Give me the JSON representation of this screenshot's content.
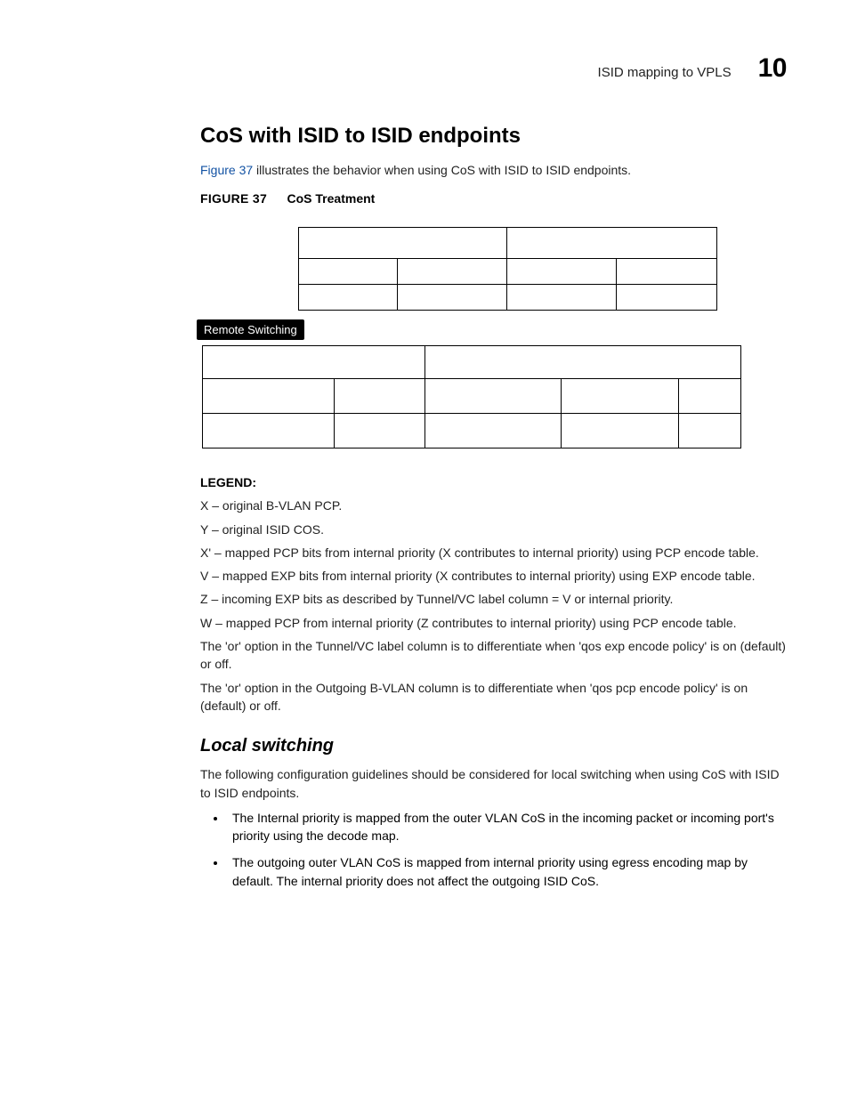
{
  "header": {
    "section": "ISID mapping to VPLS",
    "chapter": "10"
  },
  "title": "CoS with ISID to ISID endpoints",
  "intro_link": "Figure 37",
  "intro_rest": " illustrates the behavior when using CoS with ISID to ISID endpoints.",
  "figlabel": "FIGURE 37",
  "figtitle": "CoS Treatment",
  "remote_label": "Remote Switching",
  "legend_head": "LEGEND:",
  "legend": [
    "X – original B-VLAN PCP.",
    "Y – original ISID COS.",
    "X' – mapped PCP bits from internal priority (X contributes to internal priority) using PCP encode table.",
    "V – mapped EXP bits from internal priority (X contributes to internal priority) using EXP encode table.",
    "Z – incoming EXP bits as described by Tunnel/VC label column = V or internal priority.",
    "W – mapped PCP from internal priority (Z contributes to internal priority) using PCP encode table.",
    "The 'or' option in the Tunnel/VC label column is to differentiate when 'qos exp encode policy' is on (default) or off.",
    "The 'or' option in the Outgoing B-VLAN column is to differentiate when 'qos pcp encode policy' is on (default) or off."
  ],
  "subsection": "Local switching",
  "local_para": "The following configuration guidelines should be considered for local switching when using CoS with ISID to ISID endpoints.",
  "bullets": [
    "The Internal priority is mapped from the outer VLAN CoS in the incoming packet or incoming port's priority using the decode map.",
    "The outgoing outer VLAN CoS is mapped from internal priority using egress encoding map by default. The internal priority does not affect the outgoing ISID CoS."
  ]
}
